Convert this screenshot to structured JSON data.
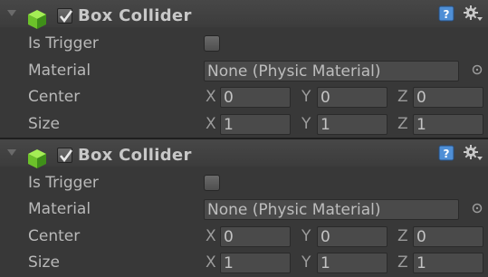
{
  "components": [
    {
      "title": "Box Collider",
      "enabled": true,
      "icons": {
        "cube": "box-collider-cube-icon",
        "help": "help-book-icon",
        "settings": "gear-icon",
        "foldout": "foldout-triangle-icon"
      },
      "is_trigger": {
        "label": "Is Trigger",
        "checked": false
      },
      "material": {
        "label": "Material",
        "value": "None (Physic Material)"
      },
      "center": {
        "label": "Center",
        "x_label": "X",
        "x": "0",
        "y_label": "Y",
        "y": "0",
        "z_label": "Z",
        "z": "0"
      },
      "size": {
        "label": "Size",
        "x_label": "X",
        "x": "1",
        "y_label": "Y",
        "y": "1",
        "z_label": "Z",
        "z": "1"
      }
    },
    {
      "title": "Box Collider",
      "enabled": true,
      "icons": {
        "cube": "box-collider-cube-icon",
        "help": "help-book-icon",
        "settings": "gear-icon",
        "foldout": "foldout-triangle-icon"
      },
      "is_trigger": {
        "label": "Is Trigger",
        "checked": false
      },
      "material": {
        "label": "Material",
        "value": "None (Physic Material)"
      },
      "center": {
        "label": "Center",
        "x_label": "X",
        "x": "0",
        "y_label": "Y",
        "y": "0",
        "z_label": "Z",
        "z": "0"
      },
      "size": {
        "label": "Size",
        "x_label": "X",
        "x": "1",
        "y_label": "Y",
        "y": "1",
        "z_label": "Z",
        "z": "1"
      }
    }
  ],
  "colors": {
    "background": "#383838",
    "cube_green": "#6cc22a",
    "help_blue": "#4f8fd6"
  }
}
